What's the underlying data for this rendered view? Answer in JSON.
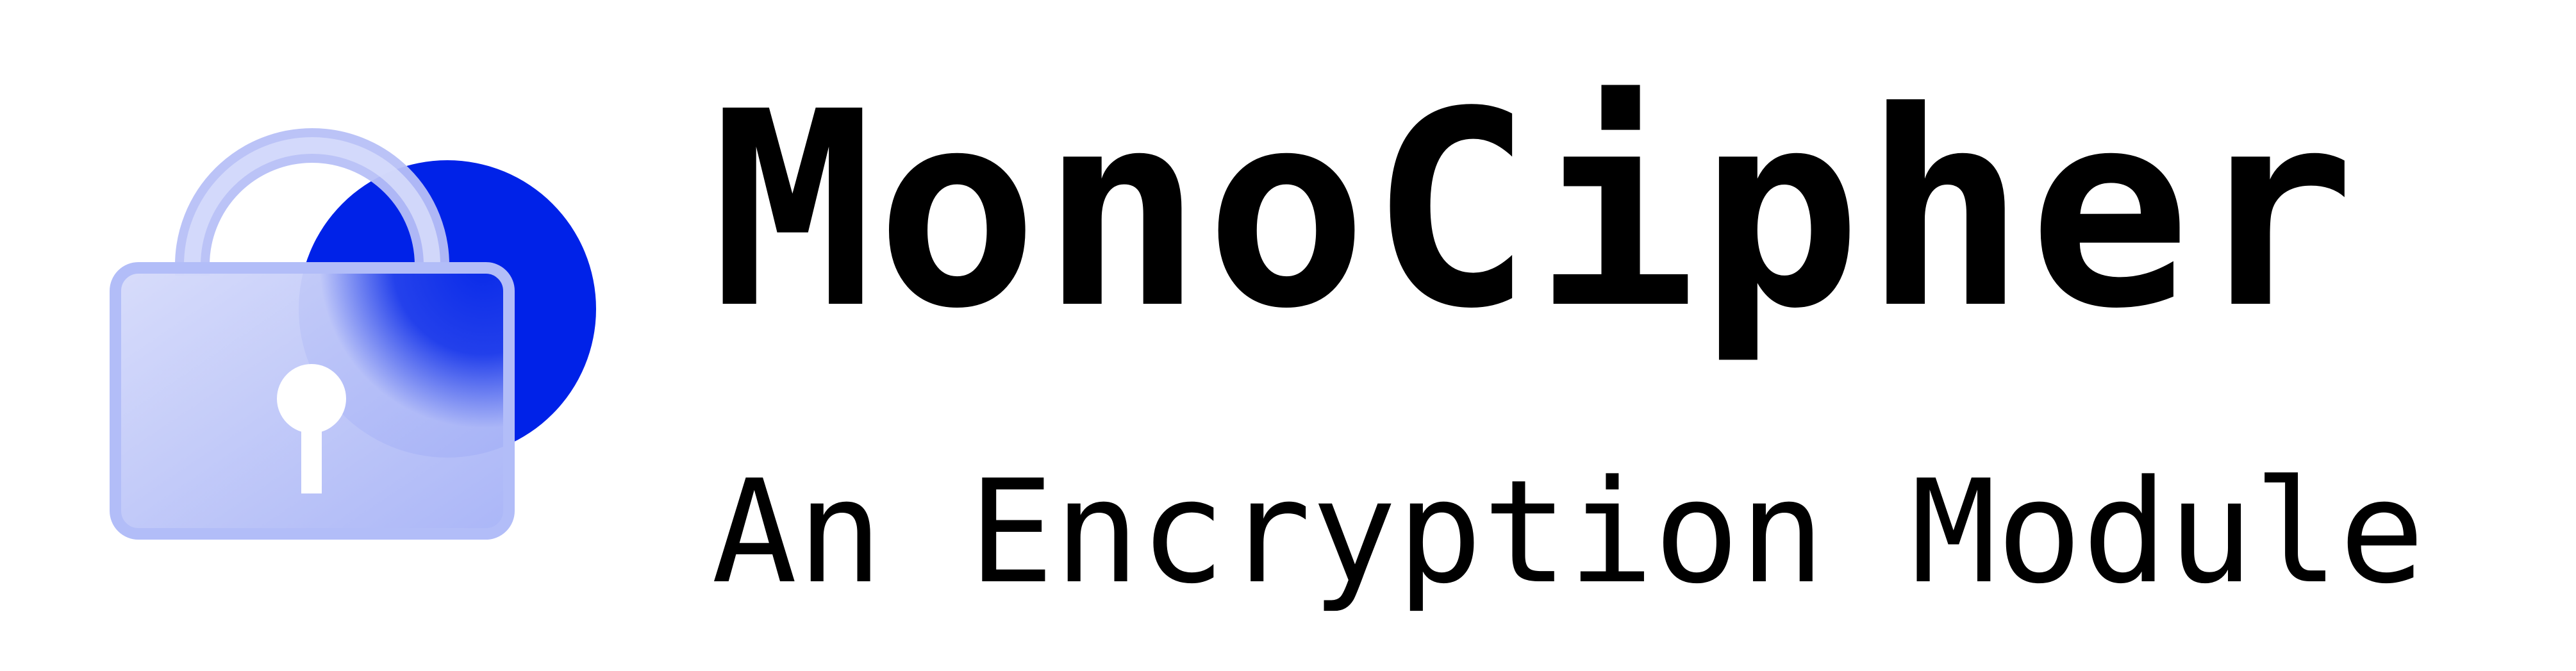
{
  "brand": {
    "name": "MonoCipher",
    "tagline": "An Encryption Module"
  },
  "logo": {
    "icon": "padlock-with-circle-icon",
    "circle_color": "#0022E8",
    "lock_color": "#A9B5F8",
    "keyhole_color": "#FFFFFF"
  },
  "colors": {
    "background": "#FFFFFF",
    "text": "#000000"
  }
}
